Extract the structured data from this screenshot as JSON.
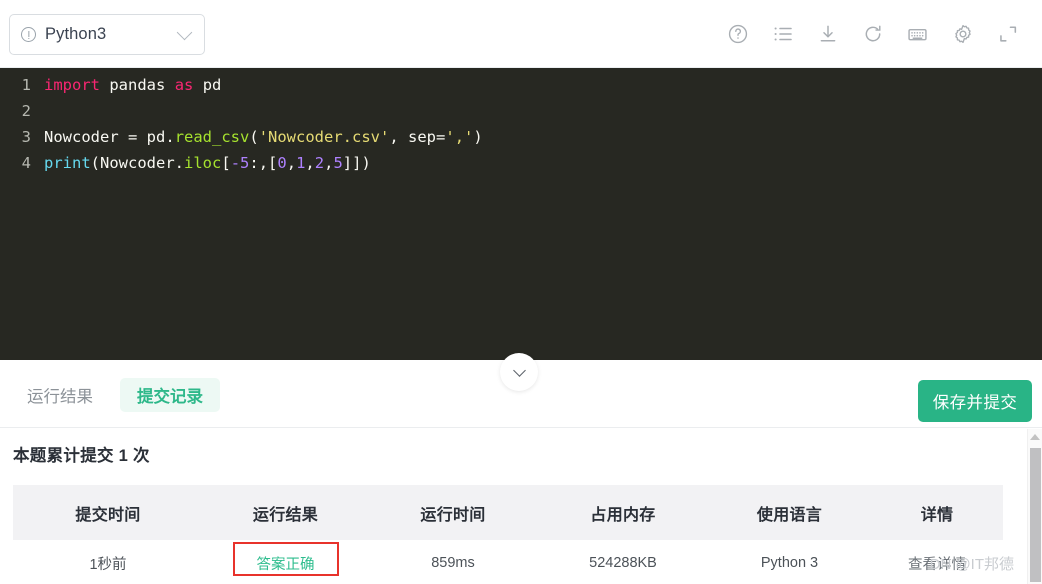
{
  "header": {
    "language_select": {
      "value": "Python3",
      "warn_icon": "exclamation-circle-icon",
      "chevron_icon": "chevron-down-icon"
    },
    "tools": [
      {
        "name": "help-icon",
        "title": "帮助"
      },
      {
        "name": "list-icon",
        "title": "题目列表"
      },
      {
        "name": "download-icon",
        "title": "下载代码"
      },
      {
        "name": "refresh-icon",
        "title": "重置代码"
      },
      {
        "name": "keyboard-icon",
        "title": "快捷键"
      },
      {
        "name": "gear-icon",
        "title": "设置"
      },
      {
        "name": "expand-icon",
        "title": "全屏"
      }
    ]
  },
  "editor": {
    "theme_background": "#272822",
    "language": "python",
    "lines": [
      {
        "no": "1",
        "tokens": [
          {
            "t": "import",
            "c": "k"
          },
          {
            "t": " ",
            "c": "pl"
          },
          {
            "t": "pandas",
            "c": "pl"
          },
          {
            "t": " ",
            "c": "pl"
          },
          {
            "t": "as",
            "c": "k"
          },
          {
            "t": " ",
            "c": "pl"
          },
          {
            "t": "pd",
            "c": "pl"
          }
        ]
      },
      {
        "no": "2",
        "tokens": []
      },
      {
        "no": "3",
        "tokens": [
          {
            "t": "Nowcoder ",
            "c": "pl"
          },
          {
            "t": "= ",
            "c": "op"
          },
          {
            "t": "pd",
            "c": "pl"
          },
          {
            "t": ".",
            "c": "op"
          },
          {
            "t": "read_csv",
            "c": "fn"
          },
          {
            "t": "(",
            "c": "op"
          },
          {
            "t": "'Nowcoder.csv'",
            "c": "st"
          },
          {
            "t": ", ",
            "c": "op"
          },
          {
            "t": "sep",
            "c": "pl"
          },
          {
            "t": "=",
            "c": "op"
          },
          {
            "t": "','",
            "c": "st"
          },
          {
            "t": ")",
            "c": "op"
          }
        ]
      },
      {
        "no": "4",
        "tokens": [
          {
            "t": "print",
            "c": "bi"
          },
          {
            "t": "(",
            "c": "op"
          },
          {
            "t": "Nowcoder",
            "c": "pl"
          },
          {
            "t": ".",
            "c": "op"
          },
          {
            "t": "iloc",
            "c": "fn"
          },
          {
            "t": "[",
            "c": "op"
          },
          {
            "t": "-",
            "c": "nu"
          },
          {
            "t": "5",
            "c": "nu"
          },
          {
            "t": ":,[",
            "c": "op"
          },
          {
            "t": "0",
            "c": "nu"
          },
          {
            "t": ",",
            "c": "op"
          },
          {
            "t": "1",
            "c": "nu"
          },
          {
            "t": ",",
            "c": "op"
          },
          {
            "t": "2",
            "c": "nu"
          },
          {
            "t": ",",
            "c": "op"
          },
          {
            "t": "5",
            "c": "nu"
          },
          {
            "t": "]])",
            "c": "op"
          }
        ]
      }
    ],
    "collapse_icon": "chevron-down-icon"
  },
  "tabbar": {
    "tabs": [
      {
        "label": "运行结果",
        "active": false
      },
      {
        "label": "提交记录",
        "active": true
      }
    ],
    "submit_button": "保存并提交",
    "accent_color": "#29b486",
    "active_tab_color": "#2eb88a"
  },
  "submissions": {
    "count_title": "本题累计提交 1 次",
    "columns": [
      "提交时间",
      "运行结果",
      "运行时间",
      "占用内存",
      "使用语言",
      "详情"
    ],
    "rows": [
      {
        "time": "1秒前",
        "result": "答案正确",
        "result_color": "#2ebd8e",
        "runtime": "859ms",
        "memory": "524288KB",
        "language": "Python 3",
        "detail": "查看详情",
        "annotated": true,
        "annotation_color": "#e8322b"
      }
    ]
  },
  "watermark": "DN @IT邦德",
  "scrollbar": {
    "up_arrow_icon": "triangle-up-icon"
  }
}
